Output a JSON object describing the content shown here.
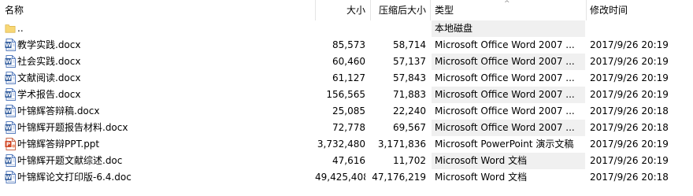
{
  "columns": {
    "name": "名称",
    "size": "大小",
    "compressed": "压缩后大小",
    "type": "类型",
    "modified": "修改时间"
  },
  "parent": {
    "name": "..",
    "type": "本地磁盘"
  },
  "files": [
    {
      "name": "教学实践.docx",
      "size": "85,573",
      "compressed": "58,714",
      "type": "Microsoft Office Word 2007 ...",
      "modified": "2017/9/26 20:19",
      "icon": "word-icon"
    },
    {
      "name": "社会实践.docx",
      "size": "60,460",
      "compressed": "57,137",
      "type": "Microsoft Office Word 2007 ...",
      "modified": "2017/9/26 20:19",
      "icon": "word-icon"
    },
    {
      "name": "文献阅读.docx",
      "size": "61,127",
      "compressed": "57,843",
      "type": "Microsoft Office Word 2007 ...",
      "modified": "2017/9/26 20:19",
      "icon": "word-icon"
    },
    {
      "name": "学术报告.docx",
      "size": "156,565",
      "compressed": "71,883",
      "type": "Microsoft Office Word 2007 ...",
      "modified": "2017/9/26 20:19",
      "icon": "word-icon"
    },
    {
      "name": "叶锦辉答辩稿.docx",
      "size": "25,085",
      "compressed": "22,240",
      "type": "Microsoft Office Word 2007 ...",
      "modified": "2017/9/26 20:18",
      "icon": "word-icon"
    },
    {
      "name": "叶锦辉开题报告材料.docx",
      "size": "72,778",
      "compressed": "69,567",
      "type": "Microsoft Office Word 2007 ...",
      "modified": "2017/9/26 20:18",
      "icon": "word-icon"
    },
    {
      "name": "叶锦辉答辩PPT.ppt",
      "size": "3,732,480",
      "compressed": "3,171,836",
      "type": "Microsoft PowerPoint 演示文稿",
      "modified": "2017/9/26 20:19",
      "icon": "powerpoint-icon"
    },
    {
      "name": "叶锦辉开题文献综述.doc",
      "size": "47,616",
      "compressed": "11,702",
      "type": "Microsoft Word 文档",
      "modified": "2017/9/26 20:19",
      "icon": "word-icon"
    },
    {
      "name": "叶锦辉论文打印版-6.4.doc",
      "size": "49,425,408",
      "compressed": "47,176,219",
      "type": "Microsoft Word 文档",
      "modified": "2017/9/26 20:18",
      "icon": "word-icon"
    }
  ],
  "colors": {
    "type_column_shade": "#f0f0f0",
    "word_icon": "#2b579a",
    "powerpoint_icon": "#d24726",
    "folder_icon": "#f8d775"
  }
}
